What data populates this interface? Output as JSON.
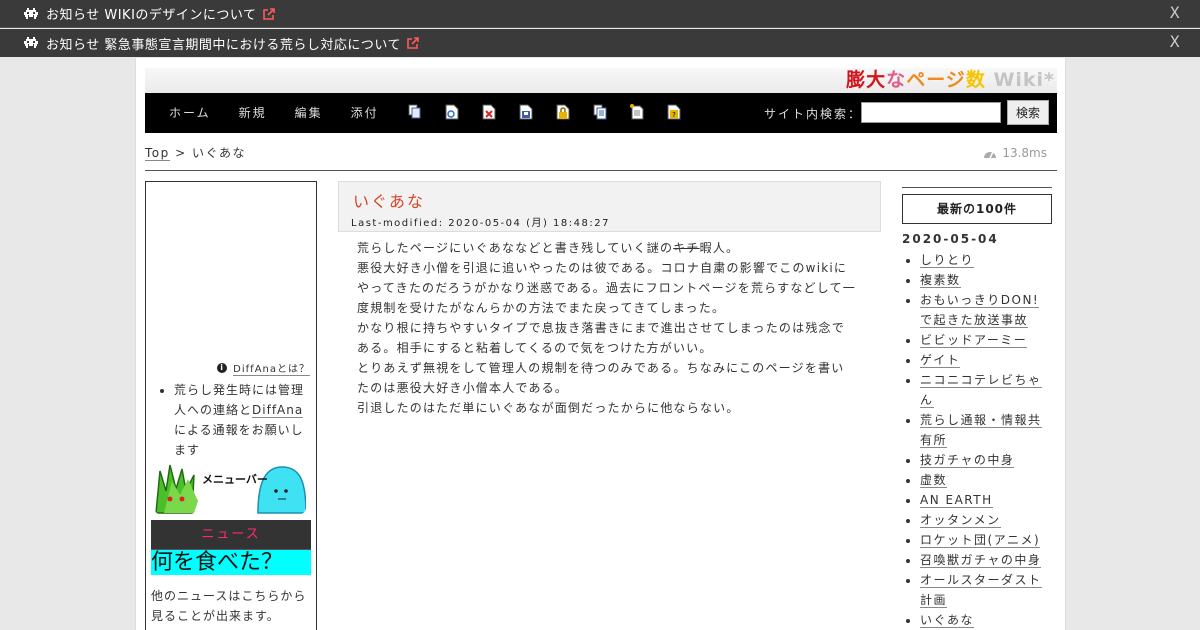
{
  "notices": [
    {
      "label": "お知らせ WIKIのデザインについて",
      "close": "X"
    },
    {
      "label": "お知らせ 緊急事態宣言期間中における荒らし対応について",
      "close": "X"
    }
  ],
  "banner": {
    "parts": [
      "膨大",
      "な",
      "ページ",
      "数",
      " Wiki*"
    ]
  },
  "nav": {
    "links": [
      "ホーム",
      "新規",
      "編集",
      "添付"
    ],
    "icons": [
      "copy-icon",
      "diff-icon",
      "delete-icon",
      "save-icon",
      "lock-icon",
      "list-icon",
      "new-page-icon",
      "help-icon"
    ],
    "search_label": "サイト内検索：",
    "search_button": "検索"
  },
  "breadcrumb": {
    "top": "Top",
    "sep": " > ",
    "current": "いぐあな"
  },
  "timer": "13.8ms",
  "left": {
    "diff_help": "DiffAnaとは？",
    "notice_parts": [
      "荒らし発生時には管理人への連絡と",
      "DiffAna",
      "による通報をお願いします"
    ],
    "menubar_label": "メニューバー",
    "news_head": "ニュース",
    "news_banner": "何を食べた？",
    "news_more": "他のニュースはこちらから見ることが出来ます。"
  },
  "article": {
    "title": "いぐあな",
    "modified": "Last-modified: 2020-05-04 (月) 18:48:27",
    "lines": [
      [
        "荒らしたページにいぐあななどと書き残していく謎の",
        "キチ",
        "暇人。"
      ],
      [
        "悪役大好き小僧を引退に追いやったのは彼である。コロナ自粛の影響でこのwikiにやってきたのだろうがかなり迷惑である。過去にフロントページを荒らすなどして一度規制を受けたがなんらかの方法でまた戻ってきてしまった。"
      ],
      [
        "かなり根に持ちやすいタイプで息抜き落書きにまで進出させてしまったのは残念である。相手にすると粘着してくるので気をつけた方がいい。"
      ],
      [
        "とりあえず無視をして管理人の規制を待つのみである。ちなみにこのページを書いたのは悪役大好き小僧本人である。"
      ],
      [
        "引退したのはただ単にいぐあなが面倒だったからに他ならない。"
      ]
    ]
  },
  "right": {
    "latest": "最新の100件",
    "date": "2020-05-04",
    "items": [
      "しりとり",
      "複素数",
      "おもいっきりDON!で起きた放送事故",
      "ビビッドアーミー",
      "ゲイト",
      "ニコニコテレビちゃん",
      "荒らし通報・情報共有所",
      "技ガチャの中身",
      "虚数",
      "AN EARTH",
      "オッタンメン",
      "ロケット団(アニメ)",
      "召喚獣ガチャの中身",
      "オールスターダスト計画",
      "いぐあな"
    ]
  },
  "colors": {
    "accent_red": "#d4121b",
    "title_red": "#d9452a",
    "news_pink": "#ff2b6e",
    "news_cyan": "#00ffff"
  }
}
